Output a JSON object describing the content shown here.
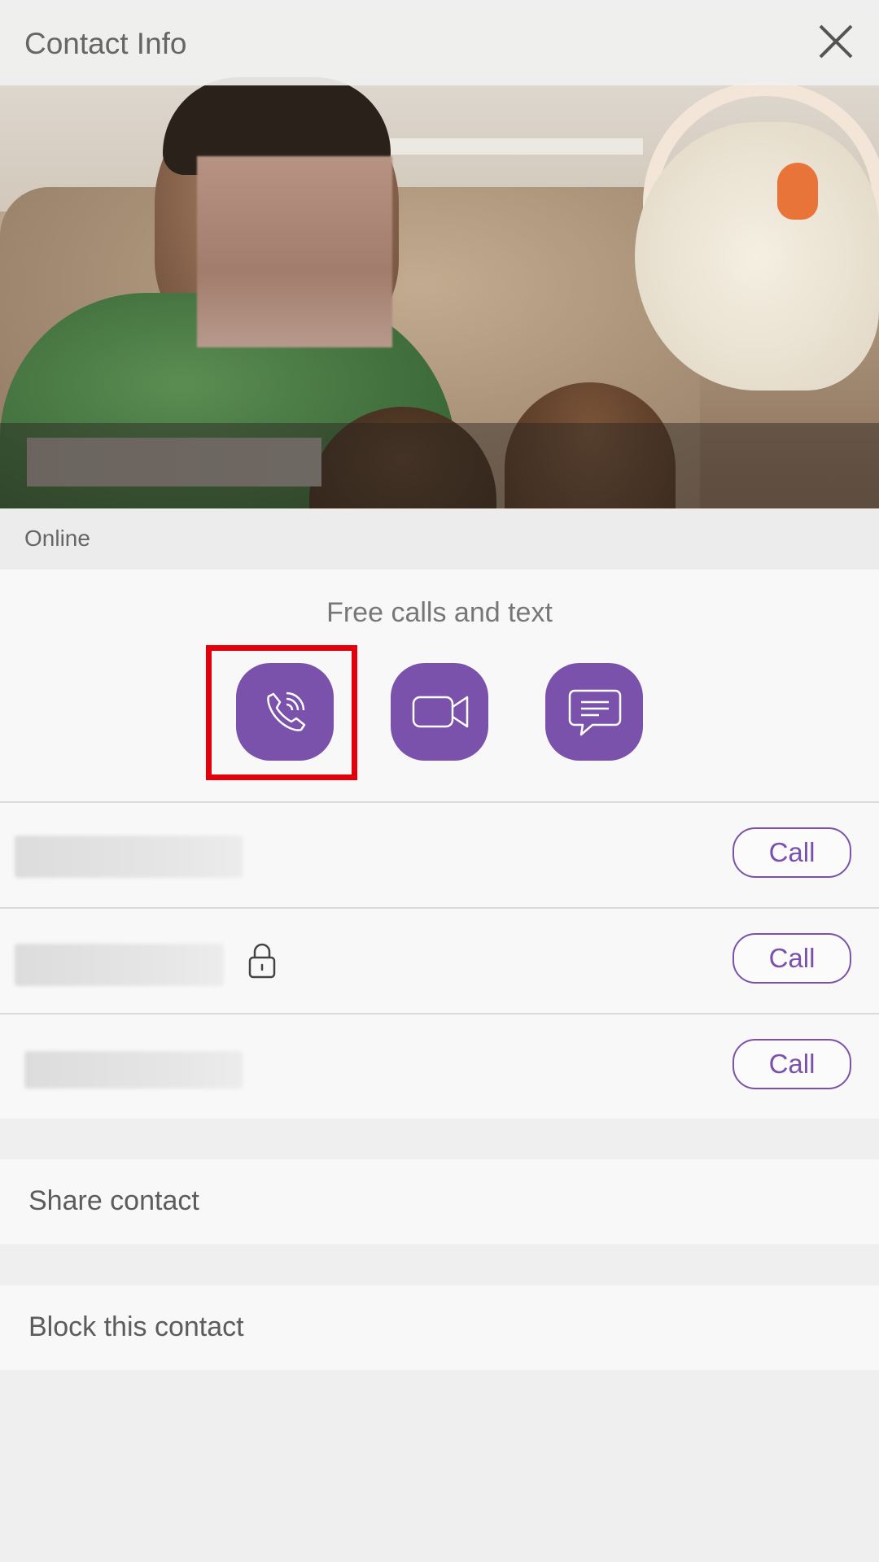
{
  "header": {
    "title": "Contact Info",
    "close_icon": "close-icon"
  },
  "status": {
    "text": "Online"
  },
  "actions": {
    "heading": "Free calls and text",
    "buttons": [
      {
        "name": "free-call-button",
        "icon": "phone-icon"
      },
      {
        "name": "video-call-button",
        "icon": "video-camera-icon"
      },
      {
        "name": "message-button",
        "icon": "chat-bubble-icon"
      }
    ],
    "highlight_color": "#e3000b"
  },
  "phone_numbers": [
    {
      "call_label": "Call",
      "locked": false
    },
    {
      "call_label": "Call",
      "locked": true
    },
    {
      "call_label": "Call",
      "locked": false
    }
  ],
  "menu": {
    "share_label": "Share contact",
    "block_label": "Block this contact"
  },
  "colors": {
    "accent": "#7b52ab",
    "background": "#efefef",
    "card": "#f8f8f8"
  }
}
